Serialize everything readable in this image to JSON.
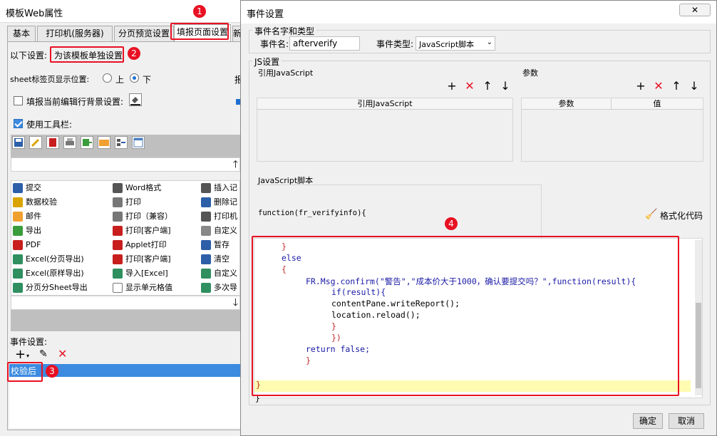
{
  "left_window": {
    "title": "模板Web属性",
    "tabs": [
      "基本",
      "打印机(服务器)",
      "分页预览设置",
      "填报页面设置",
      "新"
    ],
    "settings_label": "以下设置:",
    "settings_value": "为该模板单独设置",
    "sheet_label": "sheet标签页显示位置:",
    "radio_top": "上",
    "radio_bottom": "下",
    "cut_label": "报",
    "bg_label": "填报当前编辑行背景设置:",
    "toolbar_label": "使用工具栏:",
    "grid": [
      [
        "提交",
        "Word格式",
        "插入记"
      ],
      [
        "数据校验",
        "打印",
        "删除记"
      ],
      [
        "邮件",
        "打印（兼容）",
        "打印机"
      ],
      [
        "导出",
        "打印[客户端]",
        "自定义"
      ],
      [
        "PDF",
        "Applet打印",
        "暂存"
      ],
      [
        "Excel(分页导出)",
        "打印[客户端]",
        "清空"
      ],
      [
        "Excel(原样导出)",
        "导入[Excel]",
        "自定义"
      ],
      [
        "分页分Sheet导出",
        "显示单元格值",
        "多次导"
      ]
    ],
    "event_label": "事件设置:",
    "event_item": "校验后"
  },
  "dialog": {
    "title": "事件设置",
    "name_type_legend": "事件名字和类型",
    "event_name_label": "事件名:",
    "event_name_value": "afterverify",
    "event_type_label": "事件类型:",
    "event_type_value": "JavaScript脚本",
    "js_settings_legend": "JS设置",
    "ref_js_legend": "引用JavaScript",
    "ref_js_header": "引用JavaScript",
    "params_legend": "参数",
    "params_header_1": "参数",
    "params_header_2": "值",
    "script_legend": "JavaScript脚本",
    "signature": "function(fr_verifyinfo){",
    "format_label": "格式化代码",
    "closing": "}",
    "ok": "确定",
    "cancel": "取消"
  },
  "code_lines": [
    "}",
    "else",
    "{",
    "FR.Msg.confirm(\"警告\",\"成本价大于1000，确认要提交吗？\",function(result){",
    "if(result){",
    "contentPane.writeReport();",
    "location.reload();",
    "}",
    "})",
    "return false;",
    "}",
    "}"
  ],
  "annotations": [
    "1",
    "2",
    "3",
    "4"
  ],
  "colors": {
    "annotation": "#e81123",
    "selection": "#3c8be0",
    "highlight": "#fffbb0"
  }
}
